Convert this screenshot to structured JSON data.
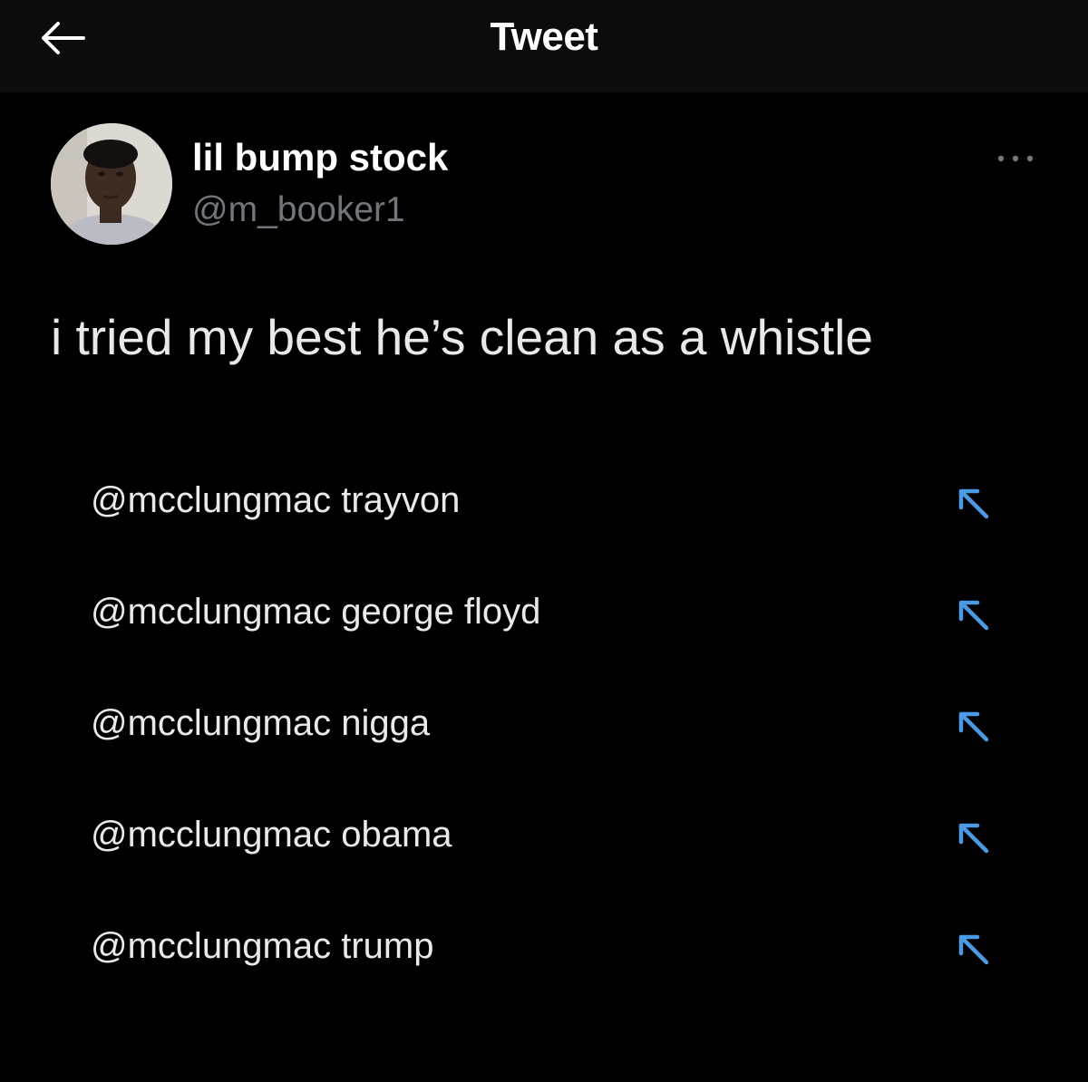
{
  "header": {
    "title": "Tweet",
    "back_icon": "arrow-left-icon"
  },
  "tweet": {
    "author": {
      "display_name": "lil bump stock",
      "handle": "@m_booker1",
      "avatar": "avatar-photo"
    },
    "more_icon": "more-horizontal-icon",
    "text": "i tried my best he’s clean as a whistle"
  },
  "suggestions": {
    "icon": "arrow-up-left-icon",
    "items": [
      {
        "label": "@mcclungmac trayvon"
      },
      {
        "label": "@mcclungmac george floyd"
      },
      {
        "label": "@mcclungmac nigga"
      },
      {
        "label": "@mcclungmac obama"
      },
      {
        "label": "@mcclungmac trump"
      }
    ]
  },
  "colors": {
    "background": "#000000",
    "header_background": "#0c0c0c",
    "primary_text": "#e7e9ea",
    "secondary_text": "#71767b",
    "accent": "#4a9ae6"
  }
}
